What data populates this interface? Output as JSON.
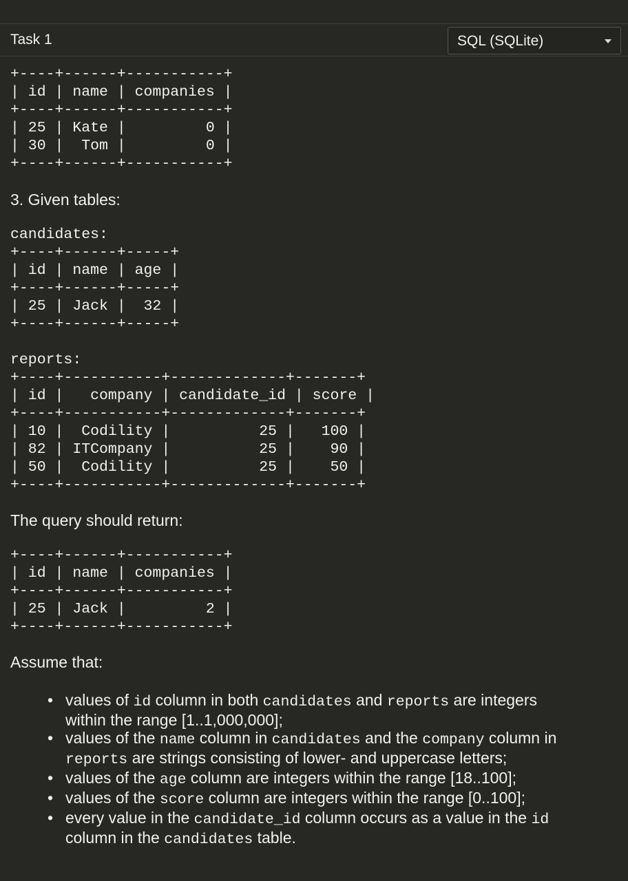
{
  "header": {
    "task_title": "Task 1",
    "language": "SQL (SQLite)"
  },
  "table_prev": {
    "text": "+----+------+-----------+\n| id | name | companies |\n+----+------+-----------+\n| 25 | Kate |         0 |\n| 30 |  Tom |         0 |\n+----+------+-----------+"
  },
  "example3": {
    "heading": "3. Given tables:",
    "candidates_label": "candidates:",
    "candidates_table": "+----+------+-----+\n| id | name | age |\n+----+------+-----+\n| 25 | Jack |  32 |\n+----+------+-----+",
    "reports_label": "reports:",
    "reports_table": "+----+-----------+-------------+-------+\n| id |   company | candidate_id | score |\n+----+-----------+-------------+-------+\n| 10 |  Codility |          25 |   100 |\n| 82 | ITCompany |          25 |    90 |\n| 50 |  Codility |          25 |    50 |\n+----+-----------+-------------+-------+",
    "query_text": "The query should return:",
    "result_table": "+----+------+-----------+\n| id | name | companies |\n+----+------+-----------+\n| 25 | Jack |         2 |\n+----+------+-----------+"
  },
  "assumptions": {
    "heading": "Assume that:",
    "items": [
      {
        "p1": "values of ",
        "c1": "id",
        "p2": " column in both ",
        "c2": "candidates",
        "p3": " and ",
        "c3": "reports",
        "p4": " are integers within the range [1..1,000,000];"
      },
      {
        "p1": "values of the ",
        "c1": "name",
        "p2": " column in ",
        "c2": "candidates",
        "p3": " and the ",
        "c3": "company",
        "p4": " column in ",
        "c4": "reports",
        "p5": " are strings consisting of lower- and uppercase letters;"
      },
      {
        "p1": "values of the ",
        "c1": "age",
        "p2": " column are integers within the range [18..100];"
      },
      {
        "p1": "values of the ",
        "c1": "score",
        "p2": " column are integers within the range [0..100];"
      },
      {
        "p1": "every value in the ",
        "c1": "candidate_id",
        "p2": " column occurs as a value in the ",
        "c2": "id",
        "p3": " column in the ",
        "c3": "candidates",
        "p4": " table."
      }
    ]
  }
}
